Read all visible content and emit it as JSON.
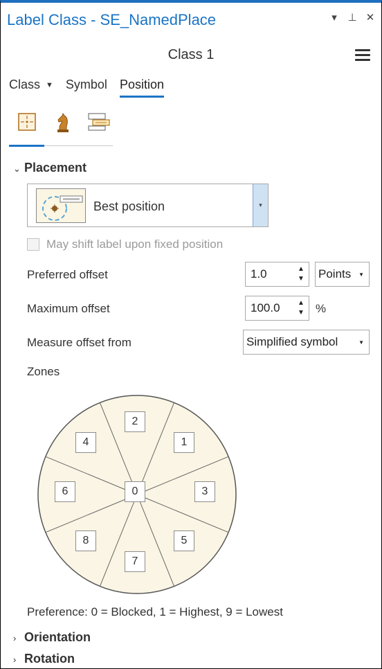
{
  "window": {
    "title": "Label Class - SE_NamedPlace",
    "controls": [
      "▾",
      "⊥",
      "✕"
    ]
  },
  "header": {
    "class_name": "Class 1"
  },
  "tabs": [
    {
      "label": "Class"
    },
    {
      "label": "Symbol"
    },
    {
      "label": "Position"
    }
  ],
  "placement": {
    "heading": "Placement",
    "selected_option": "Best position",
    "shift_checkbox_label": "May shift label upon fixed position",
    "shift_checked": false,
    "preferred_offset": {
      "label": "Preferred offset",
      "value": "1.0",
      "unit": "Points"
    },
    "maximum_offset": {
      "label": "Maximum offset",
      "value": "100.0",
      "unit": "%"
    },
    "measure_offset": {
      "label": "Measure offset from",
      "value": "Simplified symbol"
    },
    "zones_label": "Zones",
    "zones": {
      "z0": "0",
      "z1": "1",
      "z2": "2",
      "z3": "3",
      "z4": "4",
      "z5": "5",
      "z6": "6",
      "z7": "7",
      "z8": "8"
    },
    "legend": "Preference: 0 = Blocked, 1 = Highest, 9 = Lowest"
  },
  "sections": {
    "orientation": "Orientation",
    "rotation": "Rotation"
  },
  "colors": {
    "accent": "#1a74c6",
    "zone_fill": "#faf5e4",
    "dropdown_button": "#cfe2f3"
  }
}
